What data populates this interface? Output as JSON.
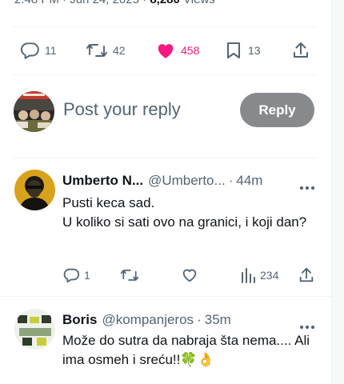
{
  "tweet_meta": {
    "time": "2:48 PM",
    "date": "Jun 24, 2025",
    "sep": "·",
    "views_count": "8,280",
    "views_label": "Views"
  },
  "action_bar": {
    "replies": "11",
    "reposts": "42",
    "likes": "458",
    "bookmarks": "13",
    "liked_color": "#f91880"
  },
  "composer": {
    "placeholder": "Post your reply",
    "button_label": "Reply"
  },
  "replies": [
    {
      "name": "Umberto N...",
      "handle": "@Umberto...",
      "sep": "·",
      "time": "44m",
      "text": "Pusti keca sad.\nU koliko si sati ovo na granici, i koji dan?",
      "replies": "1",
      "reposts": "",
      "likes": "",
      "views": "234"
    },
    {
      "name": "Boris",
      "handle": "@kompanjeros",
      "sep": "·",
      "time": "35m",
      "text": "Može do sutra da nabraja šta nema.... Ali ima osmeh i sreću!!🍀👌"
    }
  ]
}
